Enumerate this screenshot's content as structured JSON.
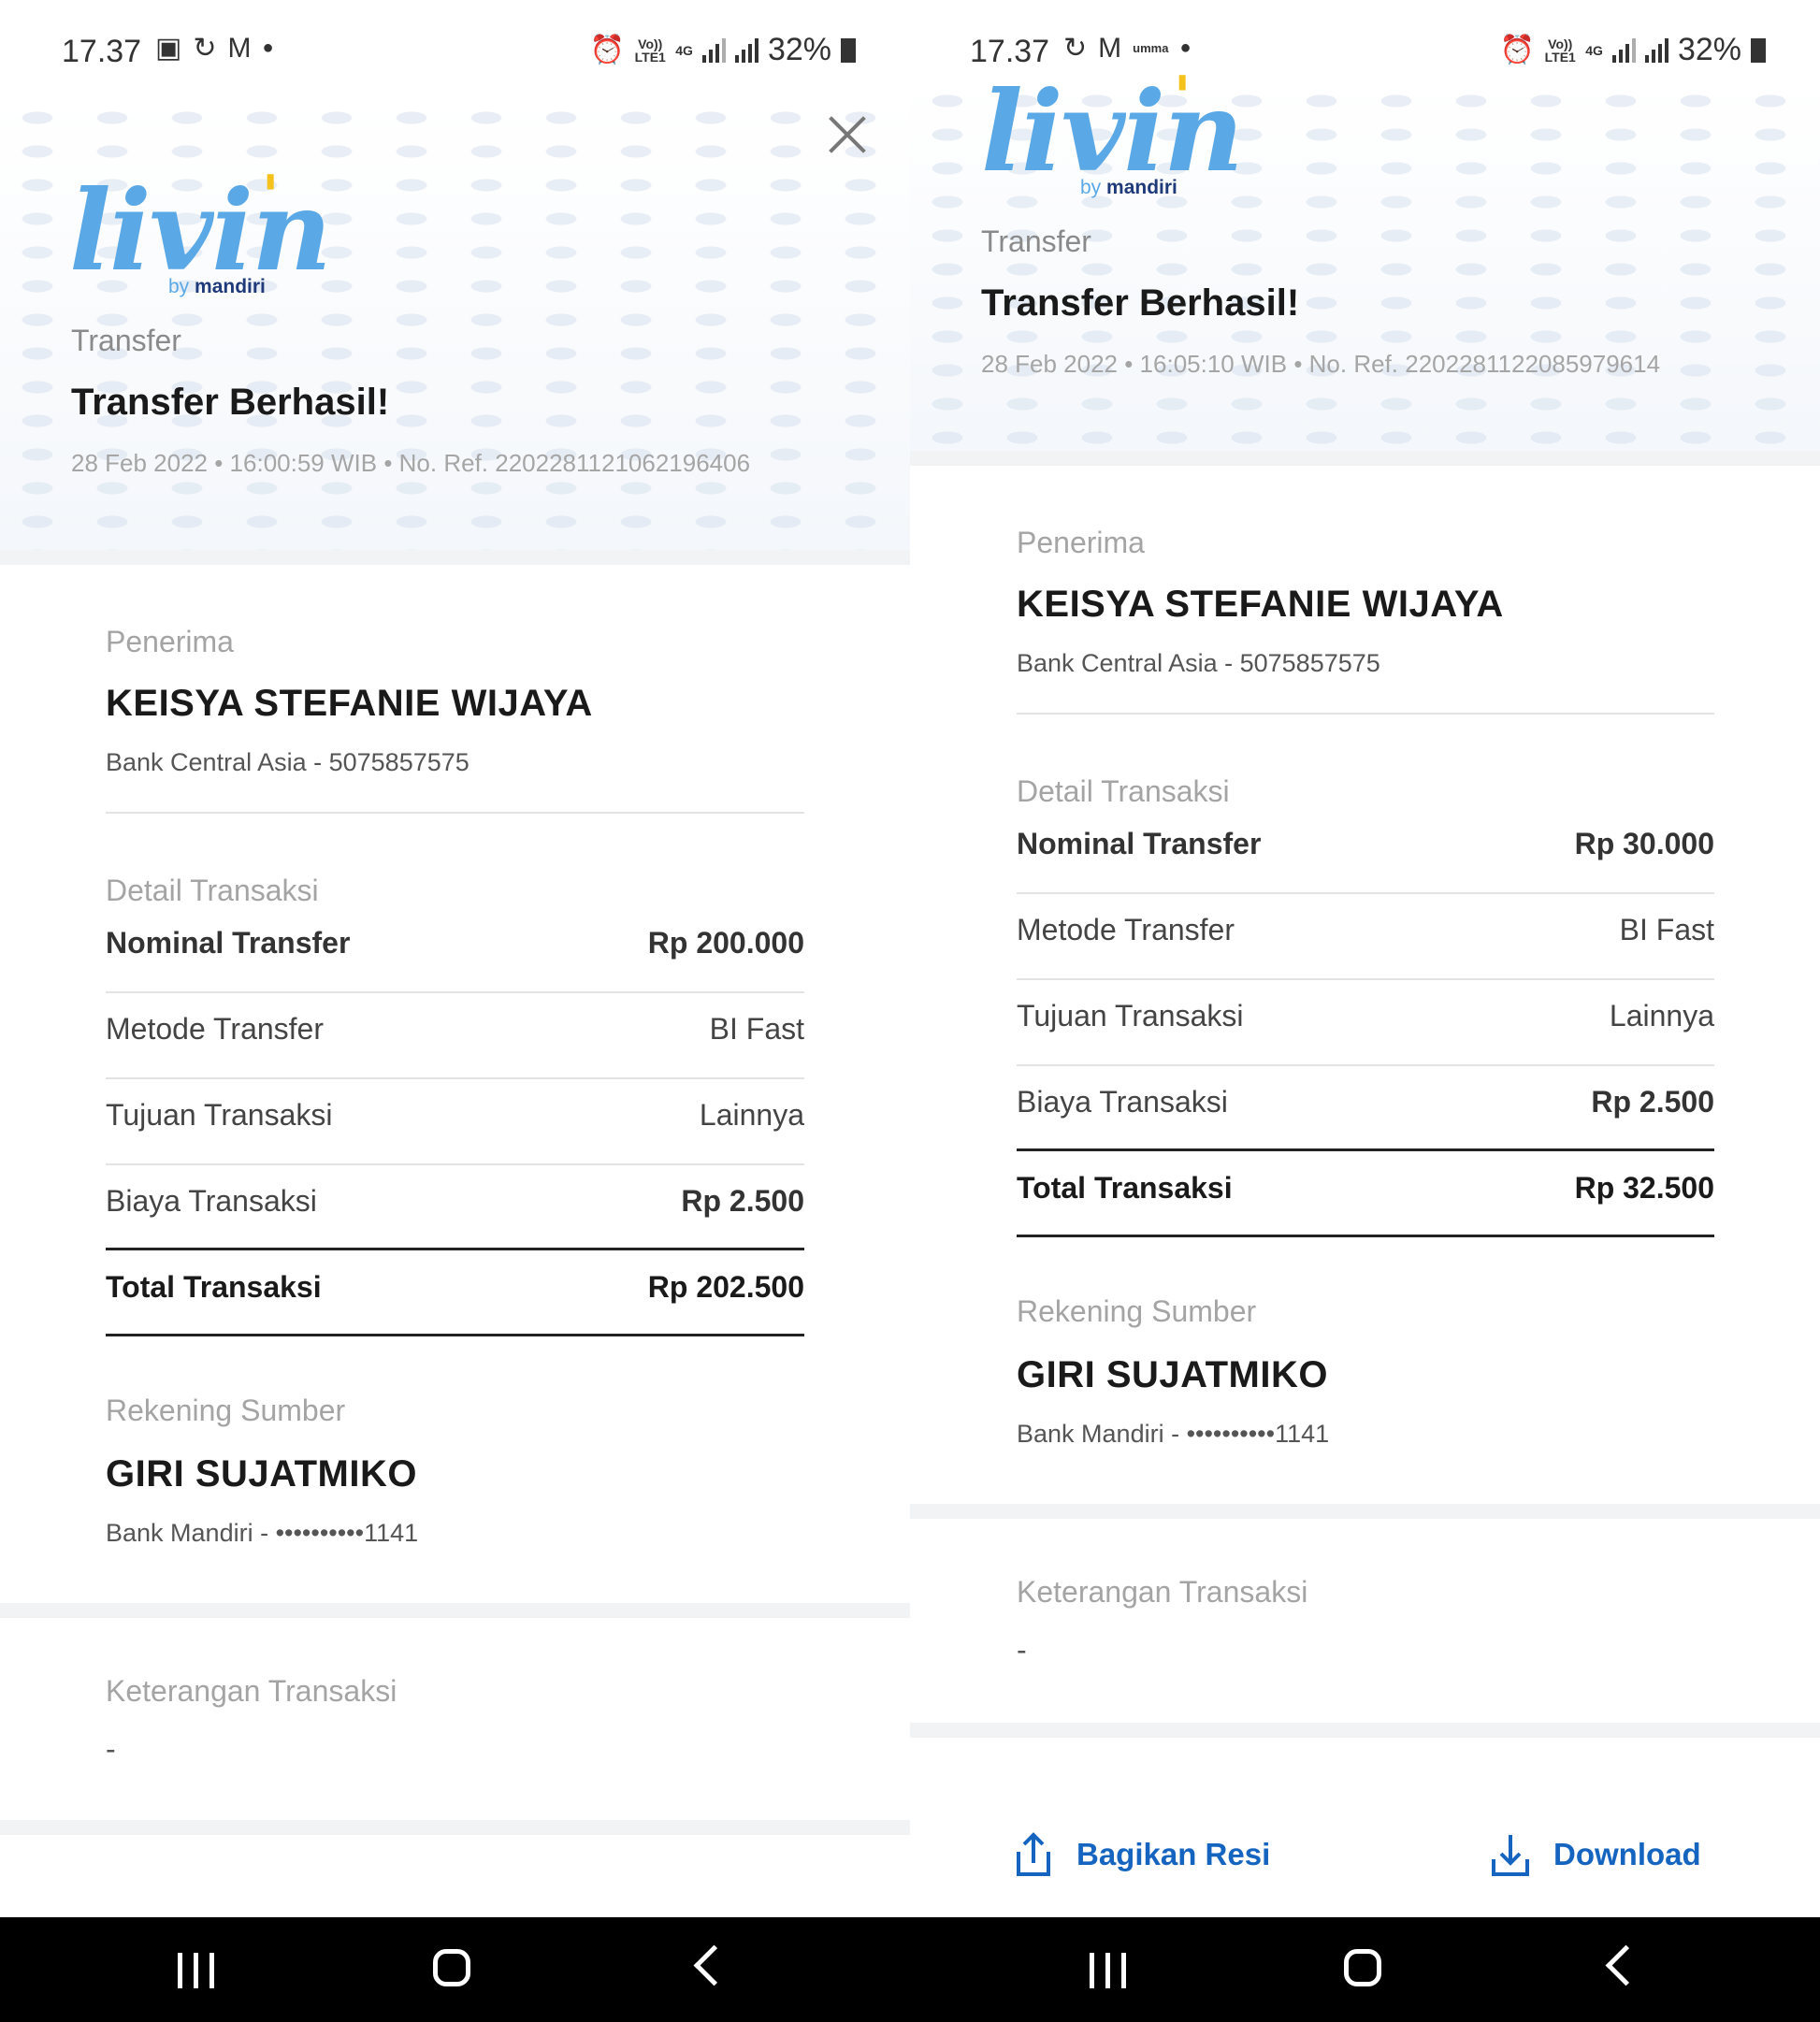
{
  "left": {
    "status": {
      "time": "17.37",
      "battery": "32%",
      "network": "4G",
      "volte": "Vo)) LTE1"
    },
    "header": {
      "logo_text": "livin",
      "logo_by": "by",
      "logo_brand": "mandiri",
      "category": "Transfer",
      "title": "Transfer Berhasil!",
      "meta": "28 Feb 2022 • 16:00:59 WIB • No. Ref. 2202281121062196406"
    },
    "recipient": {
      "label": "Penerima",
      "name": "KEISYA STEFANIE WIJAYA",
      "bank": "Bank Central Asia - 5075857575"
    },
    "details": {
      "label": "Detail Transaksi",
      "rows": [
        {
          "k": "Nominal Transfer",
          "v": "Rp 200.000"
        },
        {
          "k": "Metode Transfer",
          "v": "BI Fast"
        },
        {
          "k": "Tujuan Transaksi",
          "v": "Lainnya"
        },
        {
          "k": "Biaya Transaksi",
          "v": "Rp 2.500"
        }
      ],
      "total": {
        "k": "Total Transaksi",
        "v": "Rp 202.500"
      }
    },
    "source": {
      "label": "Rekening Sumber",
      "name": "GIRI SUJATMIKO",
      "bank": "Bank Mandiri - ••••••••••1141"
    },
    "notes": {
      "label": "Keterangan Transaksi",
      "value": "-"
    }
  },
  "right": {
    "status": {
      "time": "17.37",
      "battery": "32%",
      "network": "4G",
      "volte": "Vo)) LTE1",
      "extra": "umma"
    },
    "header": {
      "logo_text": "livin",
      "logo_by": "by",
      "logo_brand": "mandiri",
      "category": "Transfer",
      "title": "Transfer Berhasil!",
      "meta": "28 Feb 2022 • 16:05:10 WIB • No. Ref. 2202281122085979614"
    },
    "recipient": {
      "label": "Penerima",
      "name": "KEISYA STEFANIE WIJAYA",
      "bank": "Bank Central Asia - 5075857575"
    },
    "details": {
      "label": "Detail Transaksi",
      "rows": [
        {
          "k": "Nominal Transfer",
          "v": "Rp 30.000"
        },
        {
          "k": "Metode Transfer",
          "v": "BI Fast"
        },
        {
          "k": "Tujuan Transaksi",
          "v": "Lainnya"
        },
        {
          "k": "Biaya Transaksi",
          "v": "Rp 2.500"
        }
      ],
      "total": {
        "k": "Total Transaksi",
        "v": "Rp 32.500"
      }
    },
    "source": {
      "label": "Rekening Sumber",
      "name": "GIRI SUJATMIKO",
      "bank": "Bank Mandiri - ••••••••••1141"
    },
    "notes": {
      "label": "Keterangan Transaksi",
      "value": "-"
    },
    "actions": {
      "share": "Bagikan Resi",
      "download": "Download"
    }
  },
  "colors": {
    "accent": "#1565c0",
    "logo": "#5aa9e6",
    "logo_dot": "#f4c21b",
    "brand_dark": "#1f3a7a"
  }
}
